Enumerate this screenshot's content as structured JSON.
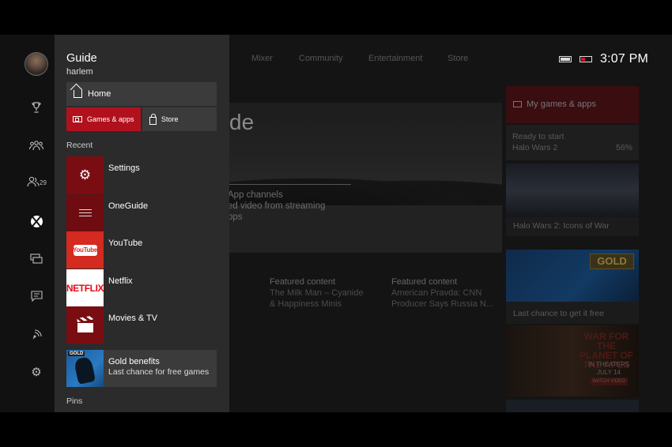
{
  "status": {
    "time": "3:07 PM"
  },
  "background": {
    "nav_tabs": [
      "Mixer",
      "Community",
      "Entertainment",
      "Store"
    ],
    "hero_title_fragment": "de",
    "hero_lines": [
      "App channels",
      "ed video from streaming",
      "pps"
    ],
    "featured": [
      {
        "label": "Featured content",
        "sub1": "The Milk Man – Cyanide",
        "sub2": "& Happiness Minis"
      },
      {
        "label": "Featured content",
        "sub1": "American Pravda: CNN",
        "sub2": "Producer Says Russia N..."
      }
    ],
    "right_column": {
      "my_games": "My games & apps",
      "ready": "Ready to start",
      "ready_game": "Halo Wars 2",
      "ready_pct": "56%",
      "halo_caption": "Halo Wars 2: Icons of War",
      "gold_badge": "GOLD",
      "gold_caption": "Last chance to get it free",
      "apes_title": "WAR FOR THE PLANET OF THE APES",
      "apes_date": "IN THEATERS JULY 14",
      "apes_btn": "WATCH VIDEO"
    }
  },
  "rail": {
    "friends_count": "29"
  },
  "guide": {
    "title": "Guide",
    "user": "harlem",
    "home_label": "Home",
    "games_label": "Games & apps",
    "store_label": "Store",
    "recent_label": "Recent",
    "pins_label": "Pins",
    "recent_items": [
      {
        "label": "Settings",
        "icon": "gear-icon",
        "bg": "#7a0d12"
      },
      {
        "label": "OneGuide",
        "icon": "lines-icon",
        "bg": "#6e0c11"
      },
      {
        "label": "YouTube",
        "icon": "youtube-icon",
        "bg": "#d42a1f"
      },
      {
        "label": "Netflix",
        "icon": "netflix-icon",
        "bg": "#ffffff"
      },
      {
        "label": "Movies & TV",
        "icon": "clapperboard-icon",
        "bg": "#7a0d12"
      }
    ],
    "gold_item": {
      "label": "Gold benefits",
      "sub": "Last chance for free games",
      "badge": "GOLD"
    },
    "youtube_logo_text": "YouTube",
    "netflix_logo_text": "NETFLIX"
  },
  "colors": {
    "accent": "#b0111d",
    "panel": "#2b2b2b",
    "tile": "#3b3b3b"
  }
}
